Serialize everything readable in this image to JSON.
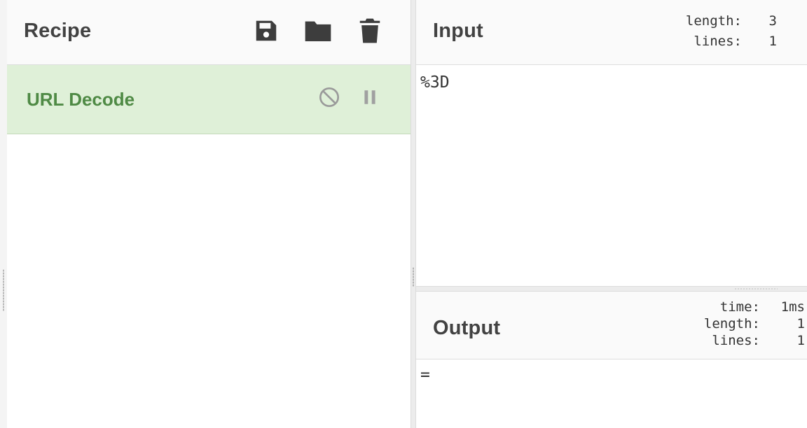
{
  "recipe": {
    "title": "Recipe",
    "icons": [
      "save-icon",
      "folder-icon",
      "trash-icon"
    ],
    "operations": [
      {
        "name": "URL Decode",
        "controls": [
          "disable-icon",
          "pause-icon"
        ]
      }
    ]
  },
  "input": {
    "title": "Input",
    "stats": {
      "length_label": "length:",
      "length": "3",
      "lines_label": "lines:",
      "lines": "1"
    },
    "value": "%3D"
  },
  "output": {
    "title": "Output",
    "stats": {
      "time_label": "time:",
      "time": "1ms",
      "length_label": "length:",
      "length": "1",
      "lines_label": "lines:",
      "lines": "1"
    },
    "value": "="
  },
  "colors": {
    "operation_bg": "#dff0d8",
    "operation_text": "#4f8a45",
    "title_text": "#424242"
  }
}
